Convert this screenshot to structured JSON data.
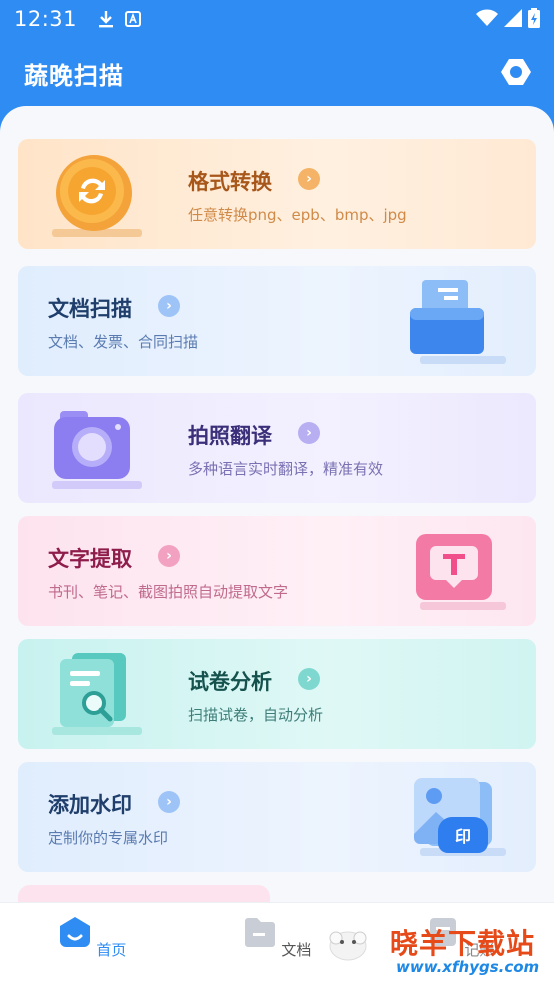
{
  "status": {
    "time": "12:31"
  },
  "app": {
    "title": "蔬晚扫描"
  },
  "cards": [
    {
      "title": "格式转换",
      "subtitle": "任意转换png、epb、bmp、jpg",
      "title_color": "#a8571b",
      "sub_color": "#d08a48",
      "chev_color": "#f4b366",
      "icon": "convert-coin-icon"
    },
    {
      "title": "文档扫描",
      "subtitle": "文档、发票、合同扫描",
      "title_color": "#1f3e6b",
      "sub_color": "#5a7bb0",
      "chev_color": "#9ec3f7",
      "icon": "document-scanner-icon"
    },
    {
      "title": "拍照翻译",
      "subtitle": "多种语言实时翻译，精准有效",
      "title_color": "#3b2f7a",
      "sub_color": "#7a71b2",
      "chev_color": "#b7aff2",
      "icon": "camera-icon"
    },
    {
      "title": "文字提取",
      "subtitle": "书刊、笔记、截图拍照自动提取文字",
      "title_color": "#8e1d4c",
      "sub_color": "#c06a8c",
      "chev_color": "#f2a2c0",
      "icon": "text-extract-icon"
    },
    {
      "title": "试卷分析",
      "subtitle": "扫描试卷，自动分析",
      "title_color": "#15524e",
      "sub_color": "#3f7d78",
      "chev_color": "#7fd8cf",
      "icon": "exam-search-icon"
    },
    {
      "title": "添加水印",
      "subtitle": "定制你的专属水印",
      "title_color": "#1f3e6b",
      "sub_color": "#5a7bb0",
      "chev_color": "#9ec3f7",
      "icon": "watermark-image-icon"
    }
  ],
  "watermark_badge": "印",
  "nav": [
    {
      "label": "首页",
      "active": true
    },
    {
      "label": "文档",
      "active": false
    },
    {
      "label": "记账",
      "active": false
    }
  ],
  "site_watermark": {
    "text": "晓羊下载站",
    "url": "www.xfhygs.com"
  }
}
